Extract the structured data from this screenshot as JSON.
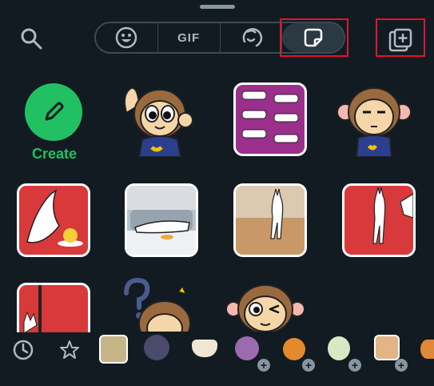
{
  "tabs": {
    "gif_label": "GIF"
  },
  "create": {
    "label": "Create"
  },
  "colors": {
    "accent": "#21c063",
    "highlight": "#e0162b",
    "background": "#121b22"
  },
  "icons": [
    "search-icon",
    "emoji-icon",
    "gif-tab",
    "avatar-icon",
    "sticker-icon",
    "add-sticker-pack-icon",
    "clock-icon",
    "star-icon",
    "plus-icon"
  ]
}
